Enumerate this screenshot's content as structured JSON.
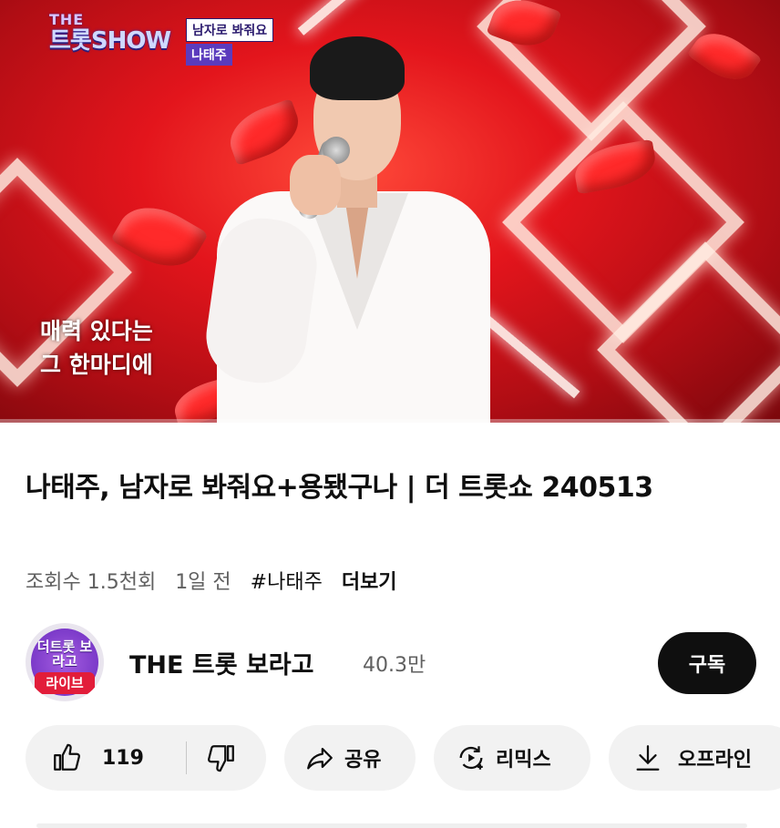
{
  "video": {
    "show_logo_small": "THE",
    "show_logo_main": "트롯SHOW",
    "song_tag": "남자로 봐줘요",
    "artist_tag": "나태주",
    "subtitle_line1": "매력 있다는",
    "subtitle_line2": "그 한마디에",
    "progress": 0.0,
    "accent_color": "#e3151c"
  },
  "info": {
    "title": "나태주, 남자로 봐줘요+용됐구나 | 더 트롯쇼 240513",
    "views": "조회수 1.5천회",
    "age": "1일 전",
    "hashtag": "#나태주",
    "more": "더보기"
  },
  "channel": {
    "avatar_text": "더트롯 보라고",
    "avatar_badge": "라이브",
    "name": "THE 트롯 보라고",
    "subscribers": "40.3만",
    "subscribe_label": "구독"
  },
  "actions": {
    "like_count": "119",
    "like_icon": "thumbs-up-icon",
    "dislike_icon": "thumbs-down-icon",
    "share_label": "공유",
    "share_icon": "share-icon",
    "remix_label": "리믹스",
    "remix_icon": "remix-icon",
    "offline_label": "오프라인",
    "offline_icon": "download-icon"
  }
}
